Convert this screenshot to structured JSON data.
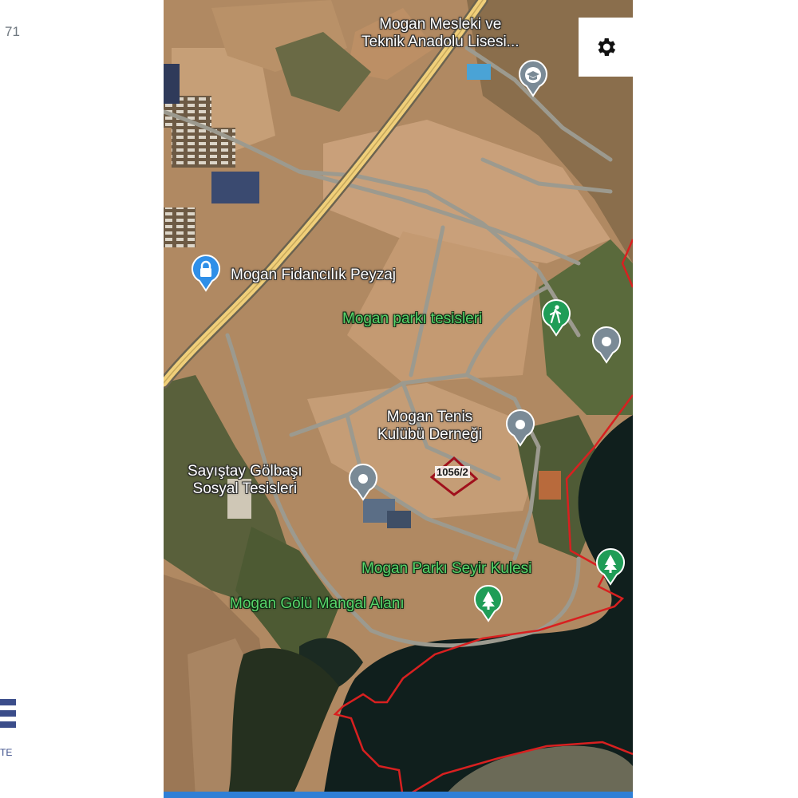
{
  "left_fragments": {
    "top": "71",
    "bottom": "TE"
  },
  "map": {
    "settings_icon": "gear-icon",
    "colors": {
      "water": "#0f1e1c",
      "boundary": "#d82020",
      "highway": "#f3d27a",
      "field": "#c79b6e",
      "vegetation": "#4a5a34",
      "pin_blue": "#2f8fe8",
      "pin_green": "#1f9d57",
      "pin_gray": "#7a8a96"
    },
    "places": [
      {
        "id": "okul",
        "lines": [
          "Mogan Mesleki ve",
          "Teknik Anadolu Lisesi..."
        ],
        "style": "white",
        "icon": "school-icon"
      },
      {
        "id": "fidancilik",
        "lines": [
          "Mogan Fidancılık Peyzaj"
        ],
        "style": "white",
        "icon": "lock-icon"
      },
      {
        "id": "park-tesis",
        "lines": [
          "Mogan parkı tesisleri"
        ],
        "style": "green",
        "icon": "hiking-icon"
      },
      {
        "id": "tenis",
        "lines": [
          "Mogan Tenis",
          "Kulübü Derneği"
        ],
        "style": "white",
        "icon": "place-icon"
      },
      {
        "id": "sayistay",
        "lines": [
          "Sayıştay Gölbaşı",
          "Sosyal Tesisleri"
        ],
        "style": "white",
        "icon": "place-icon"
      },
      {
        "id": "seyir",
        "lines": [
          "Mogan Parkı Seyir Kulesi"
        ],
        "style": "green",
        "icon": "tree-icon"
      },
      {
        "id": "mangal",
        "lines": [
          "Mogan Gölü Mangal Alanı"
        ],
        "style": "green",
        "icon": "tree-icon"
      }
    ],
    "parcel": {
      "label": "1056/2"
    }
  }
}
